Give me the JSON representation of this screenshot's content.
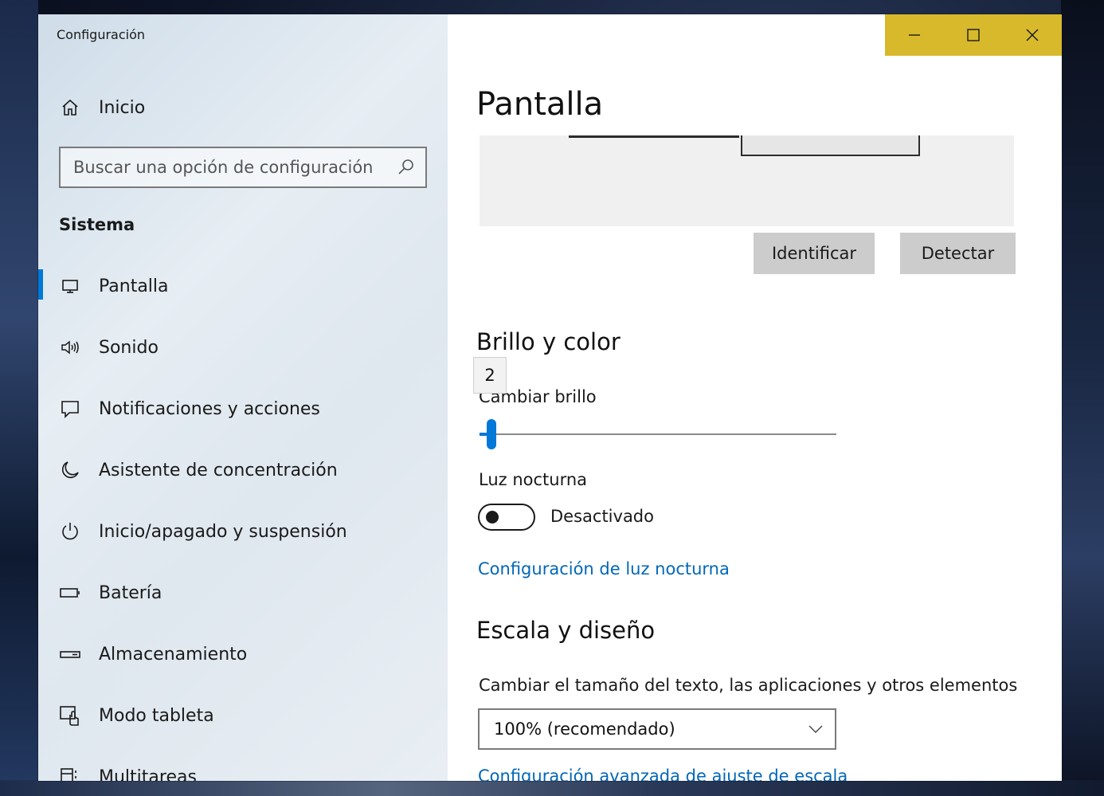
{
  "window": {
    "app_title": "Configuración",
    "controls": [
      {
        "name": "minimize-button",
        "icon": "minimize-icon"
      },
      {
        "name": "maximize-button",
        "icon": "maximize-icon"
      },
      {
        "name": "close-button",
        "icon": "close-icon"
      }
    ],
    "accent_color": "#d8b92b"
  },
  "sidebar": {
    "home": {
      "label": "Inicio",
      "icon": "home-icon"
    },
    "search": {
      "placeholder": "Buscar una opción de configuración",
      "icon": "search-icon"
    },
    "section": "Sistema",
    "items": [
      {
        "label": "Pantalla",
        "icon": "monitor-icon",
        "active": true
      },
      {
        "label": "Sonido",
        "icon": "speaker-icon"
      },
      {
        "label": "Notificaciones y acciones",
        "icon": "notification-icon"
      },
      {
        "label": "Asistente de concentración",
        "icon": "moon-icon"
      },
      {
        "label": "Inicio/apagado y suspensión",
        "icon": "power-icon"
      },
      {
        "label": "Batería",
        "icon": "battery-icon"
      },
      {
        "label": "Almacenamiento",
        "icon": "storage-icon"
      },
      {
        "label": "Modo tableta",
        "icon": "tablet-mode-icon"
      },
      {
        "label": "Multitareas",
        "icon": "multitasking-icon"
      }
    ]
  },
  "content": {
    "title": "Pantalla",
    "buttons": {
      "identify": "Identificar",
      "detect": "Detectar"
    },
    "brightness": {
      "section_title": "Brillo y color",
      "tooltip_value": "2",
      "label": "Cambiar brillo",
      "value_percent": 2
    },
    "night_light": {
      "label": "Luz nocturna",
      "state": "Desactivado",
      "settings_link": "Configuración de luz nocturna"
    },
    "scale": {
      "section_title": "Escala y diseño",
      "label": "Cambiar el tamaño del texto, las aplicaciones y otros elementos",
      "selected": "100% (recomendado)",
      "advanced_link": "Configuración avanzada de ajuste de escala"
    }
  }
}
